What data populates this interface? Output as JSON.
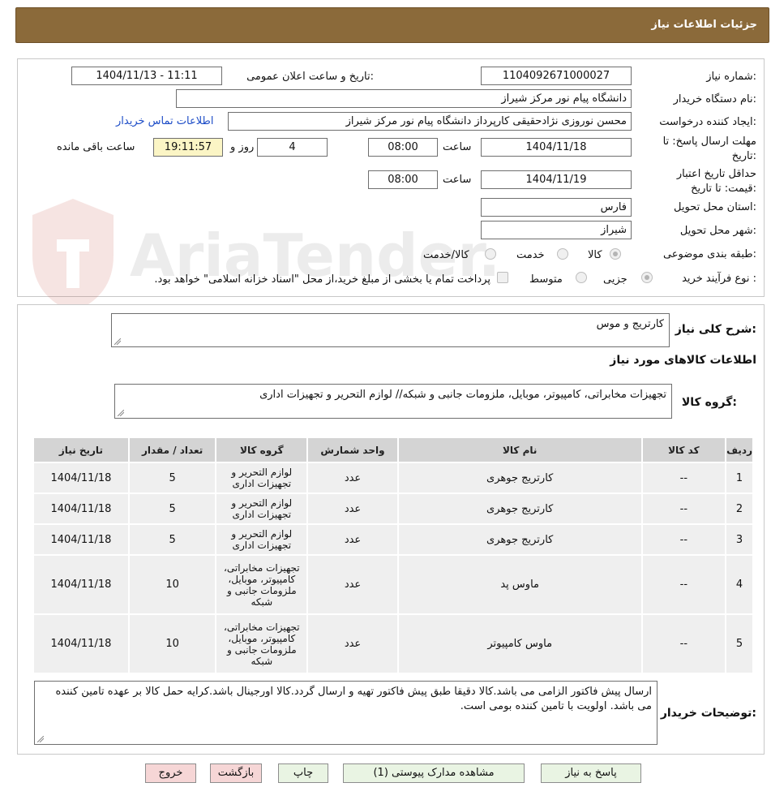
{
  "header": {
    "title": "جزئیات اطلاعات نیاز"
  },
  "form": {
    "need_number_label": "شماره نیاز:",
    "need_number": "1104092671000027",
    "announce_label": "تاریخ و ساعت اعلان عمومی:",
    "announce_value": "1404/11/13 - 11:11",
    "buyer_label": "نام دستگاه خریدار:",
    "buyer_value": "دانشگاه پیام نور مرکز شیراز",
    "creator_label": "ایجاد کننده درخواست:",
    "creator_value": "محسن نوروزی نژادحقیقی کارپرداز دانشگاه پیام نور مرکز شیراز",
    "contact_link": "اطلاعات تماس خریدار",
    "deadline_label_1": "مهلت ارسال پاسخ: تا",
    "deadline_label_2": "تاریخ:",
    "deadline_date": "1404/11/18",
    "time_label": "ساعت",
    "deadline_time": "08:00",
    "days_value": "4",
    "days_label": "روز و",
    "remaining_time": "19:11:57",
    "remaining_label": "ساعت باقی مانده",
    "validity_label_1": "حداقل تاریخ اعتبار",
    "validity_label_2": "قیمت: تا تاریخ:",
    "validity_date": "1404/11/19",
    "validity_time": "08:00",
    "province_label": "استان محل تحویل:",
    "province_value": "فارس",
    "city_label": "شهر محل تحویل:",
    "city_value": "شیراز",
    "category_label": "طبقه بندی موضوعی:",
    "category_options": [
      "کالا",
      "خدمت",
      "کالا/خدمت"
    ],
    "category_selected": "کالا",
    "process_label": "نوع فرآیند خرید :",
    "process_options": [
      "جزیی",
      "متوسط"
    ],
    "process_selected": "جزیی",
    "payment_note": "پرداخت تمام یا بخشی از مبلغ خرید،از محل \"اسناد خزانه اسلامی\" خواهد بود."
  },
  "watermark": {
    "brand": "AriaTender.neT"
  },
  "summary": {
    "general_desc_label": "شرح کلی نیاز:",
    "general_desc_value": "کارتریج و موس",
    "items_info_title": "اطلاعات کالاهای مورد نیاز",
    "goods_group_label": "گروه کالا:",
    "goods_group_value": "تجهیزات مخابراتی، کامپیوتر، موبایل، ملزومات جانبی و شبکه// لوازم التحریر و تجهیزات اداری"
  },
  "table": {
    "headers": [
      "ردیف",
      "کد کالا",
      "نام کالا",
      "واحد شمارش",
      "گروه کالا",
      "تعداد / مقدار",
      "تاریخ نیاز"
    ],
    "rows": [
      [
        "1",
        "--",
        "کارتریج جوهری",
        "عدد",
        "لوازم التحریر و تجهیزات اداری",
        "5",
        "1404/11/18"
      ],
      [
        "2",
        "--",
        "کارتریج جوهری",
        "عدد",
        "لوازم التحریر و تجهیزات اداری",
        "5",
        "1404/11/18"
      ],
      [
        "3",
        "--",
        "کارتریج جوهری",
        "عدد",
        "لوازم التحریر و تجهیزات اداری",
        "5",
        "1404/11/18"
      ],
      [
        "4",
        "--",
        "ماوس پد",
        "عدد",
        "تجهیزات مخابراتی، کامپیوتر، موبایل، ملزومات جانبی و شبکه",
        "10",
        "1404/11/18"
      ],
      [
        "5",
        "--",
        "ماوس کامپیوتر",
        "عدد",
        "تجهیزات مخابراتی، کامپیوتر، موبایل، ملزومات جانبی و شبکه",
        "10",
        "1404/11/18"
      ]
    ]
  },
  "buyer_notes": {
    "label": "توضیحات خریدار:",
    "text": "ارسال پیش فاکتور الزامی می باشد.کالا دقیقا طبق پیش فاکتور تهیه و ارسال گردد.کالا اورجینال باشد.کرایه حمل کالا بر عهده تامین کننده می باشد. اولویت با تامین کننده بومی است."
  },
  "buttons": {
    "reply": "پاسخ به نیاز",
    "attachments": "مشاهده مدارک پیوستی (1)",
    "print": "چاپ",
    "back": "بازگشت",
    "exit": "خروج"
  },
  "colors": {
    "header_bg": "#8b6a3a",
    "link": "#1c4cc7",
    "remaining_bg": "#fbf5c5",
    "button_bg": "#e9f4e3",
    "button_pink_bg": "#f6d6d6"
  }
}
